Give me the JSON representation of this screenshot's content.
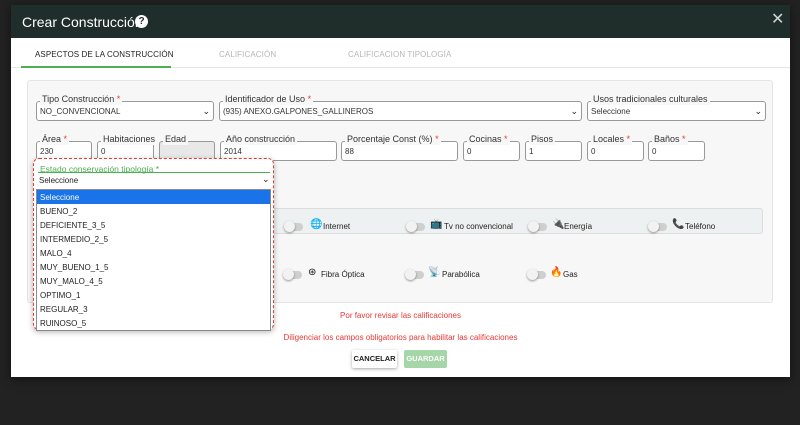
{
  "modal": {
    "title": "Crear Construcción",
    "help_glyph": "?",
    "close_glyph": "✕"
  },
  "tabs": [
    {
      "label": "ASPECTOS DE LA CONSTRUCCIÓN",
      "state": "active"
    },
    {
      "label": "CALIFICACIÓN",
      "state": "disabled"
    },
    {
      "label": "CALIFICACION TIPOLOGÍA",
      "state": "disabled"
    }
  ],
  "fields": {
    "tipo_construccion": {
      "label": "Tipo Construcción",
      "required": "*",
      "value": "NO_CONVENCIONAL"
    },
    "identificador_uso": {
      "label": "Identificador de Uso",
      "required": "*",
      "value": "(935) ANEXO.GALPONES_GALLINEROS"
    },
    "usos_tradicionales": {
      "label": "Usos tradicionales culturales",
      "value": "Seleccione"
    },
    "area": {
      "label": "Área",
      "required": "*",
      "value": "230"
    },
    "habitaciones": {
      "label": "Habitaciones",
      "value": "0"
    },
    "edad": {
      "label": "Edad",
      "value": ""
    },
    "anio_construccion": {
      "label": "Año construcción",
      "value": "2014"
    },
    "porcentaje_const": {
      "label": "Porcentaje Const (%)",
      "required": "*",
      "value": "88"
    },
    "cocinas": {
      "label": "Cocinas",
      "required": "*",
      "value": "0"
    },
    "pisos": {
      "label": "Pisos",
      "value": "1"
    },
    "locales": {
      "label": "Locales",
      "required": "*",
      "value": "0"
    },
    "banos": {
      "label": "Baños",
      "required": "*",
      "value": "0"
    }
  },
  "estado_conservacion": {
    "label": "Estado conservación tipología",
    "required": "*",
    "value": "Seleccione",
    "options": [
      "Seleccione",
      "BUENO_2",
      "DEFICIENTE_3_5",
      "INTERMEDIO_2_5",
      "MALO_4",
      "MUY_BUENO_1_5",
      "MUY_MALO_4_5",
      "OPTIMO_1",
      "REGULAR_3",
      "RUINOSO_5"
    ],
    "highlighted": "Seleccione"
  },
  "services": [
    {
      "label": "Internet",
      "icon": "globe-icon",
      "glyph": "🌐"
    },
    {
      "label": "Tv no convencional",
      "icon": "tv-icon",
      "glyph": "📺"
    },
    {
      "label": "Energía",
      "icon": "plug-icon",
      "glyph": "🔌"
    },
    {
      "label": "Teléfono",
      "icon": "phone-icon",
      "glyph": "📞"
    },
    {
      "label": "Fibra Óptica",
      "icon": "fiber-icon",
      "glyph": "⊛"
    },
    {
      "label": "Parabólica",
      "icon": "antenna-icon",
      "glyph": "📡"
    },
    {
      "label": "Gas",
      "icon": "flame-icon",
      "glyph": "🔥"
    }
  ],
  "messages": {
    "revisar": "Por favor revisar las calificaciones",
    "diligenciar": "Diligenciar los campos obligatorios para habilitar las calificaciones"
  },
  "buttons": {
    "cancel": "CANCELAR",
    "save": "GUARDAR"
  },
  "colors": {
    "header_bg": "#1f2d2b",
    "accent_green": "#4caf50",
    "error_red": "#e53935",
    "option_highlight": "#1a73e8"
  }
}
